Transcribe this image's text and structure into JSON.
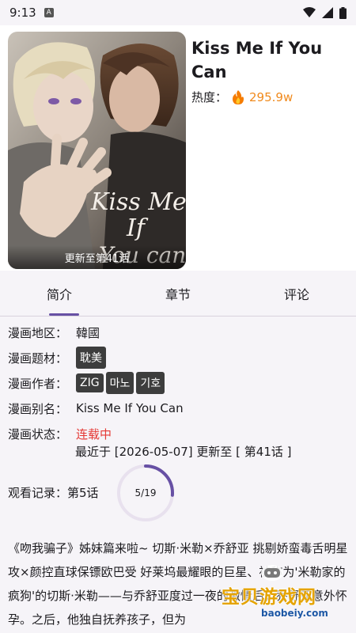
{
  "status_bar": {
    "time": "9:13",
    "notification_letter": "A"
  },
  "comic": {
    "title": "Kiss Me If You Can",
    "heat_label": "热度：",
    "heat_value": "295.9w",
    "cover_update": "更新至第41话",
    "cover_art_text": "Kiss Me If You can"
  },
  "tabs": [
    {
      "label": "简介"
    },
    {
      "label": "章节"
    },
    {
      "label": "评论"
    }
  ],
  "info": {
    "region_label": "漫画地区：",
    "region_value": "韓國",
    "genre_label": "漫画题材：",
    "genres": [
      "耽美"
    ],
    "author_label": "漫画作者：",
    "authors": [
      "ZIG",
      "마노",
      "기호"
    ],
    "alias_label": "漫画别名：",
    "alias_value": "Kiss Me If You Can",
    "state_label": "漫画状态：",
    "state_value": "连载中",
    "latest_text": "最近于 [2026-05-07] 更新至 [ 第41话 ]"
  },
  "history": {
    "label": "观看记录：",
    "value": "第5话",
    "progress_text": "5/19",
    "progress": 0.263
  },
  "description": "《吻我骗子》姊妹篇来啦~ 切斯·米勒×乔舒亚 挑剔娇蛮毒舌明星攻×颜控直球保镖欧巴受 好莱坞最耀眼的巨星、被称为'米勒家的疯狗'的切斯·米勒——与乔舒亚度过一夜的激情后，乔舒亚意外怀孕。之后，他独自抚养孩子，但为",
  "watermark": {
    "text": "宝贝游戏网",
    "url": "baobeiy.com"
  },
  "colors": {
    "accent": "#6750a4",
    "heat": "#f08a1d",
    "state": "#e53935"
  }
}
